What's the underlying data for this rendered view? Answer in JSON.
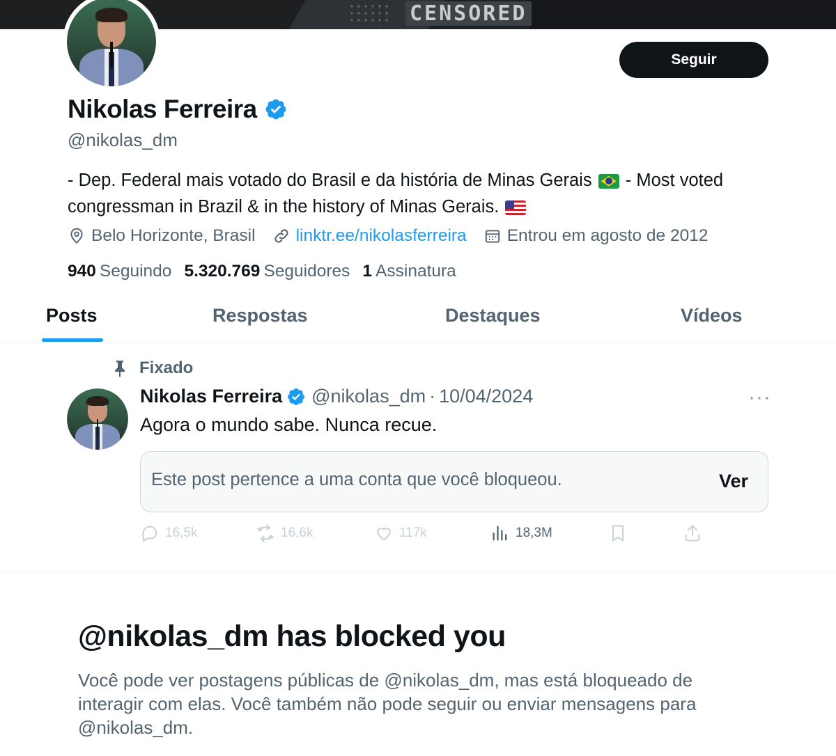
{
  "banner": {
    "text": "CENSORED"
  },
  "profile": {
    "display_name": "Nikolas Ferreira",
    "handle": "@nikolas_dm",
    "verified": true,
    "follow_label": "Seguir",
    "bio_part1": "- Dep. Federal mais votado do Brasil e da história de Minas Gerais",
    "bio_part2": "- Most voted congressman in Brazil & in the history of Minas Gerais.",
    "location": "Belo Horizonte, Brasil",
    "link": "linktr.ee/nikolasferreira",
    "joined": "Entrou em agosto de 2012",
    "stats": {
      "following_count": "940",
      "following_label": "Seguindo",
      "followers_count": "5.320.769",
      "followers_label": "Seguidores",
      "subs_count": "1",
      "subs_label": "Assinatura"
    }
  },
  "tabs": [
    {
      "label": "Posts",
      "active": true
    },
    {
      "label": "Respostas",
      "active": false
    },
    {
      "label": "Destaques",
      "active": false
    },
    {
      "label": "Vídeos",
      "active": false
    }
  ],
  "post": {
    "pinned_label": "Fixado",
    "author_name": "Nikolas Ferreira",
    "author_handle": "@nikolas_dm",
    "separator": "·",
    "date": "10/04/2024",
    "text": "Agora o mundo sabe. Nunca recue.",
    "quote_text": "Este post pertence a uma conta que você bloqueou.",
    "quote_action": "Ver",
    "replies": "16,5k",
    "reposts": "16,6k",
    "likes": "117k",
    "views": "18,3M"
  },
  "blocked": {
    "title": "@nikolas_dm has blocked you",
    "description": "Você pode ver postagens públicas de @nikolas_dm, mas está bloqueado de interagir com elas. Você também não pode seguir ou enviar mensagens para @nikolas_dm."
  },
  "colors": {
    "accent": "#1d9bf0",
    "text_primary": "#0f1419",
    "text_secondary": "#536471",
    "button_dark": "#0f1419"
  }
}
